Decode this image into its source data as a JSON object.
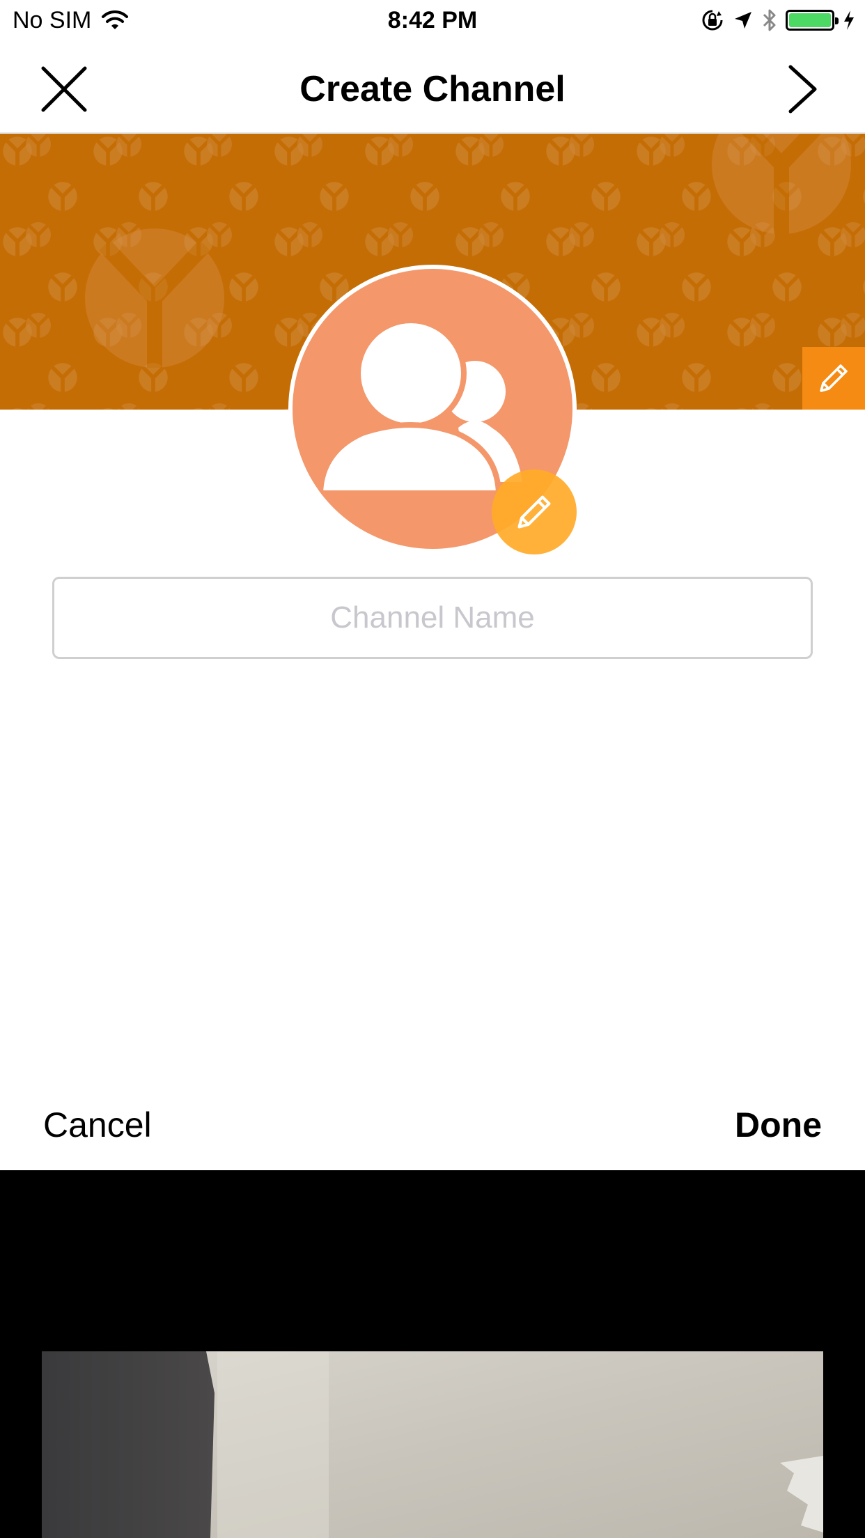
{
  "status_bar": {
    "carrier": "No SIM",
    "time": "8:42 PM",
    "battery_color": "#4cd964"
  },
  "nav": {
    "title": "Create Channel",
    "close_icon": "close-icon",
    "next_icon": "chevron-right-icon"
  },
  "cover": {
    "background_color": "#c56d05",
    "edit_icon": "pencil-icon",
    "edit_button_color": "#f58b12"
  },
  "avatar": {
    "background_color": "#f4976a",
    "icon": "group-icon",
    "edit_icon": "pencil-icon"
  },
  "form": {
    "channel_name_value": "",
    "channel_name_placeholder": "Channel Name"
  },
  "picker_toolbar": {
    "cancel_label": "Cancel",
    "done_label": "Done"
  }
}
